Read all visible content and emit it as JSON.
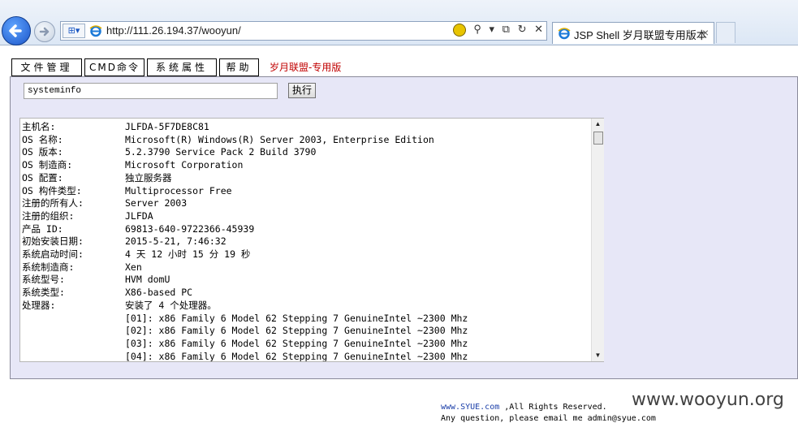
{
  "browser": {
    "url": "http://111.26.194.37/wooyun/",
    "tab_title": "JSP Shell 岁月联盟专用版本",
    "tab_close": "×",
    "tools": [
      "⚲",
      "▾",
      "⧉",
      "↻",
      "✕"
    ]
  },
  "menu": {
    "file": "文件管理",
    "cmd": "CMD命令",
    "props": "系统属性",
    "help": "帮助",
    "brand": "岁月联盟-专用版"
  },
  "command": {
    "value": "systeminfo",
    "exec_label": "执行"
  },
  "output": {
    "rows": [
      {
        "k": "主机名:",
        "v": "JLFDA-5F7DE8C81"
      },
      {
        "k": "OS 名称:",
        "v": "Microsoft(R) Windows(R) Server 2003, Enterprise Edition"
      },
      {
        "k": "OS 版本:",
        "v": "5.2.3790 Service Pack 2 Build 3790"
      },
      {
        "k": "OS 制造商:",
        "v": "Microsoft Corporation"
      },
      {
        "k": "OS 配置:",
        "v": "独立服务器"
      },
      {
        "k": "OS 构件类型:",
        "v": "Multiprocessor Free"
      },
      {
        "k": "注册的所有人:",
        "v": "Server 2003"
      },
      {
        "k": "注册的组织:",
        "v": "JLFDA"
      },
      {
        "k": "产品 ID:",
        "v": "69813-640-9722366-45939"
      },
      {
        "k": "初始安装日期:",
        "v": "2015-5-21, 7:46:32"
      },
      {
        "k": "系统启动时间:",
        "v": "4 天 12 小时 15 分 19 秒"
      },
      {
        "k": "系统制造商:",
        "v": "Xen"
      },
      {
        "k": "系统型号:",
        "v": "HVM domU"
      },
      {
        "k": "系统类型:",
        "v": "X86-based PC"
      },
      {
        "k": "处理器:",
        "v": "安装了 4 个处理器。"
      },
      {
        "k": "",
        "v": "[01]: x86 Family 6 Model 62 Stepping 7 GenuineIntel ~2300 Mhz"
      },
      {
        "k": "",
        "v": "[02]: x86 Family 6 Model 62 Stepping 7 GenuineIntel ~2300 Mhz"
      },
      {
        "k": "",
        "v": "[03]: x86 Family 6 Model 62 Stepping 7 GenuineIntel ~2300 Mhz"
      },
      {
        "k": "",
        "v": "[04]: x86 Family 6 Model 62 Stepping 7 GenuineIntel ~2300 Mhz"
      }
    ]
  },
  "footer": {
    "link": "www.SYUE.com",
    "rights": " ,All Rights Reserved.",
    "contact": "Any question, please email me admin@syue.com"
  },
  "watermark": "www.wooyun.org"
}
